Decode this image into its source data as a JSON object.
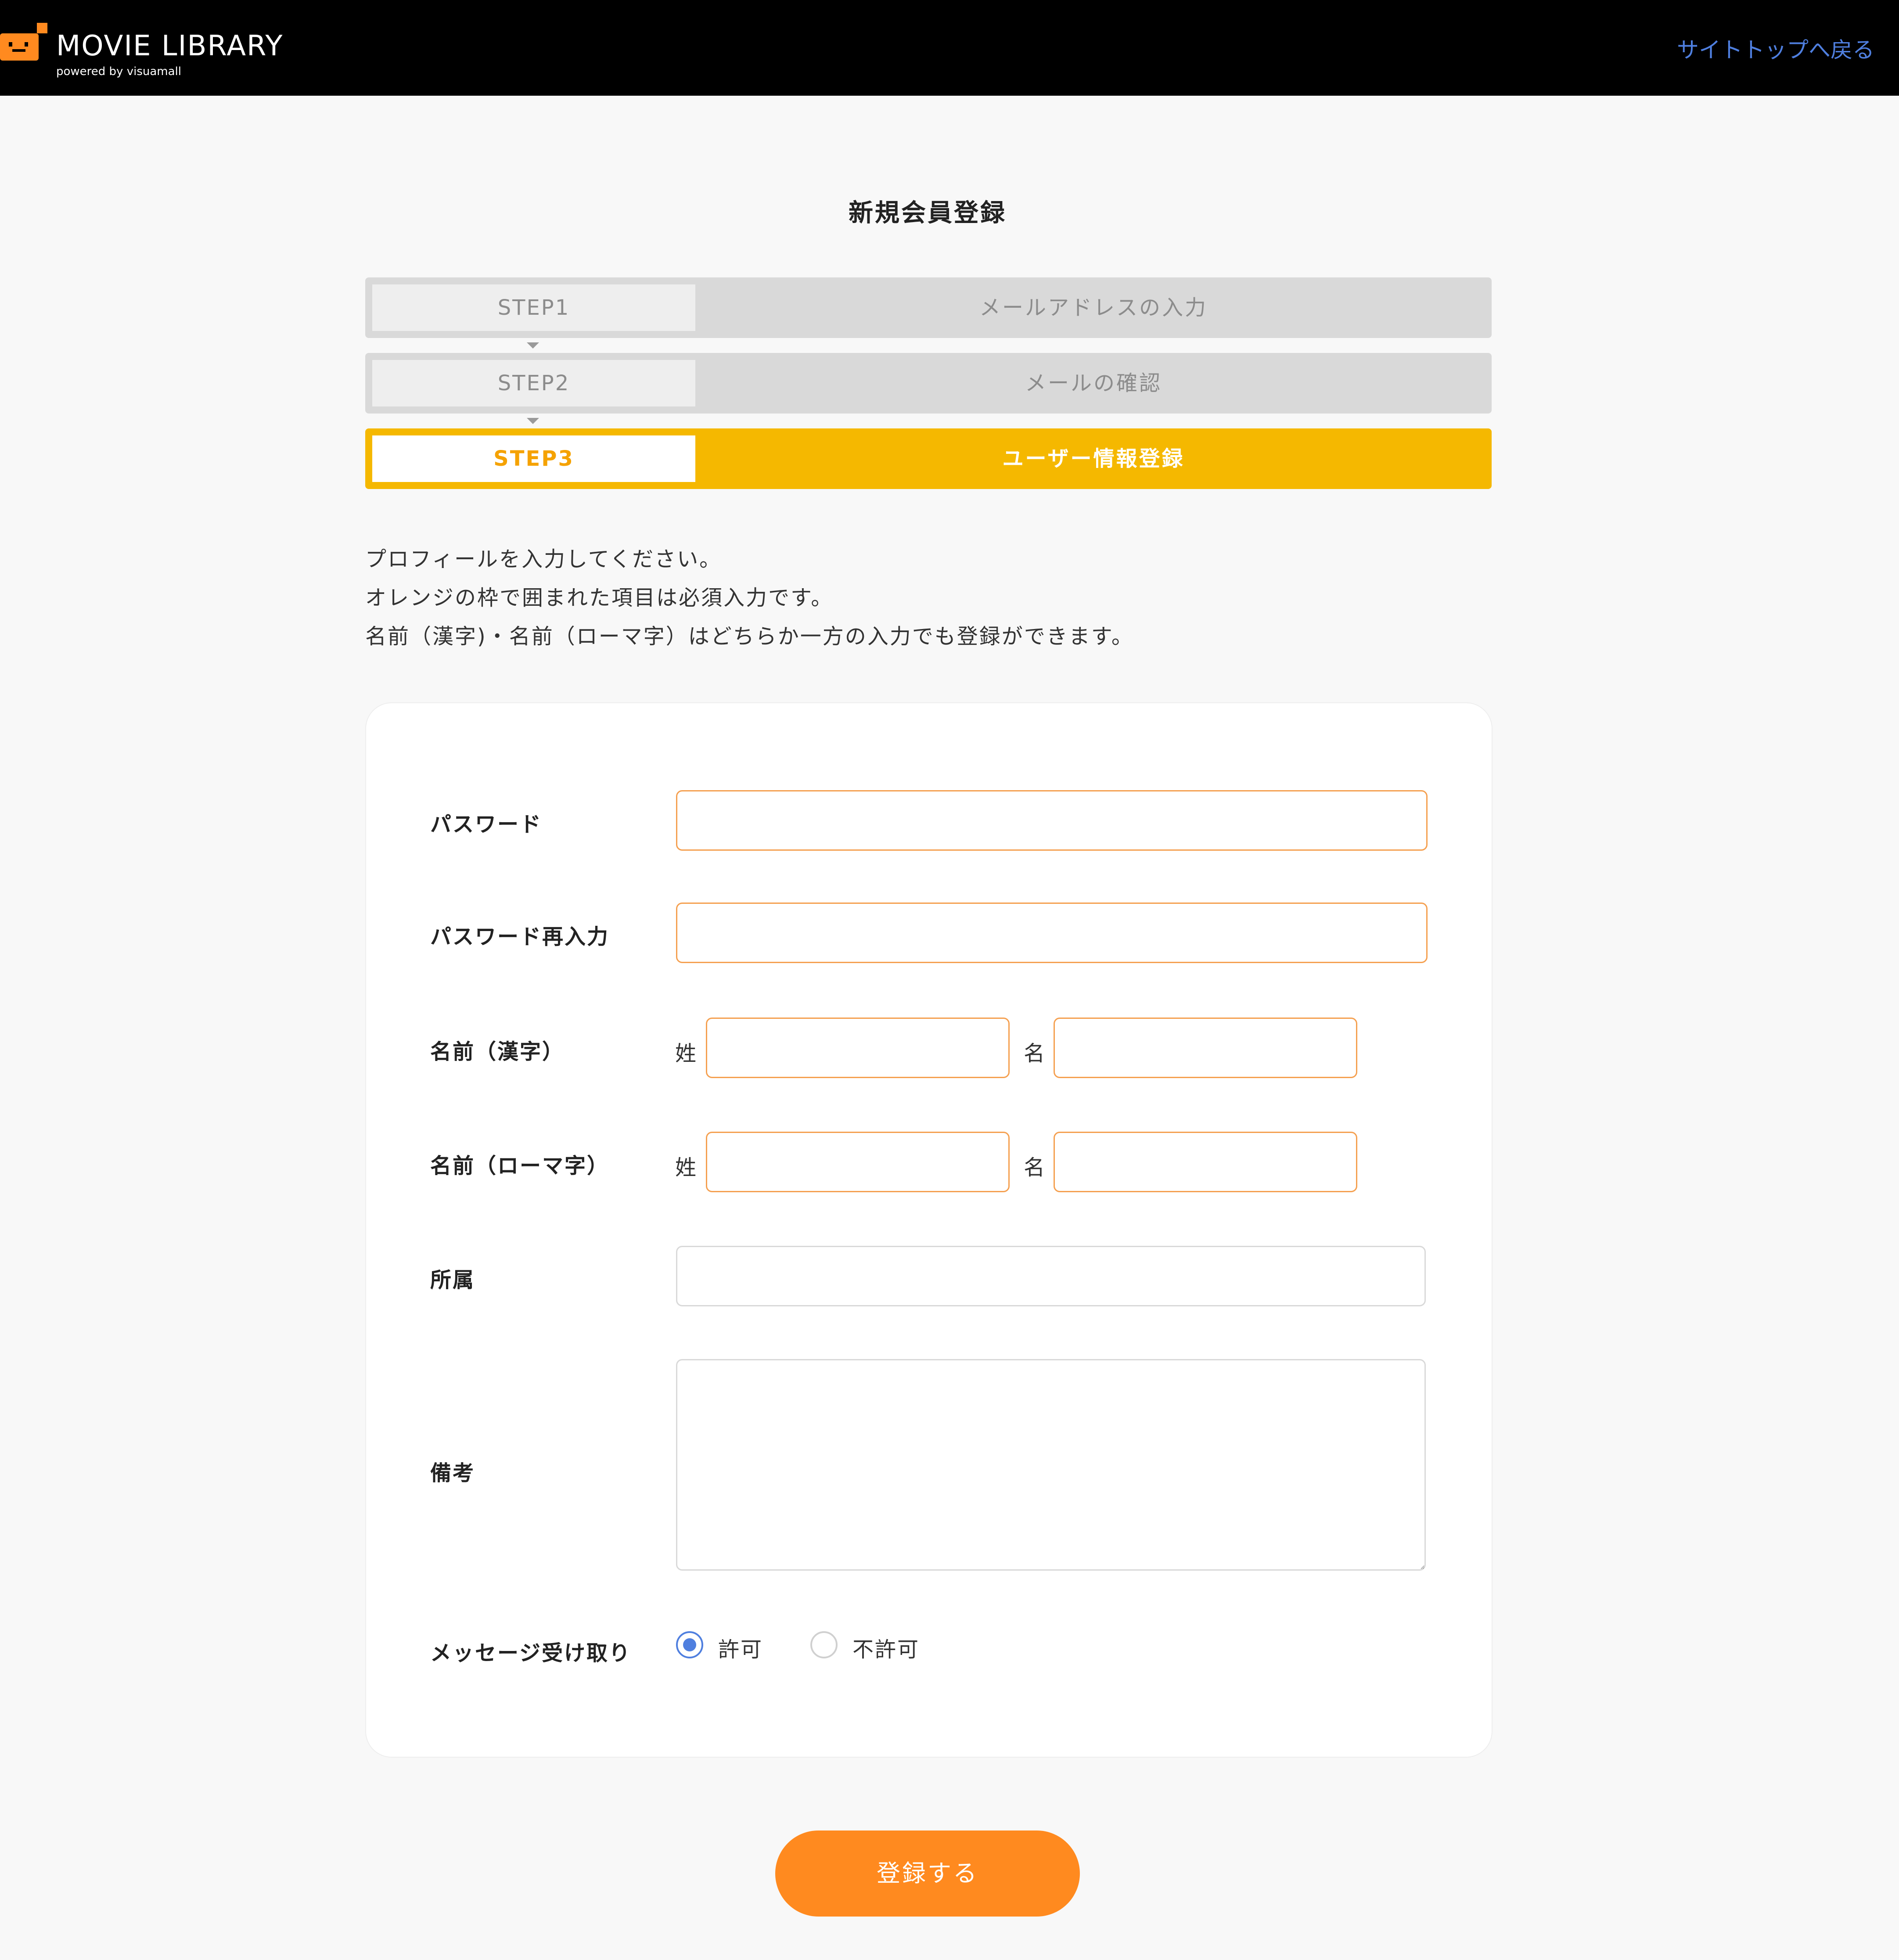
{
  "header": {
    "logo_title": "MOVIE LIBRARY",
    "logo_subtitle": "powered by visuamall",
    "back_link": "サイトトップへ戻る",
    "logo_color": "#ff8a1f"
  },
  "page": {
    "title": "新規会員登録"
  },
  "steps": [
    {
      "number": "STEP1",
      "label": "メールアドレスの入力",
      "state": "done"
    },
    {
      "number": "STEP2",
      "label": "メールの確認",
      "state": "done"
    },
    {
      "number": "STEP3",
      "label": "ユーザー情報登録",
      "state": "active"
    }
  ],
  "intro": {
    "lines": [
      "プロフィールを入力してください。",
      "オレンジの枠で囲まれた項目は必須入力です。",
      "名前（漢字)・名前（ローマ字）はどちらか一方の入力でも登録ができます。"
    ]
  },
  "form": {
    "password": {
      "label": "パスワード",
      "value": "",
      "required": true
    },
    "password_confirm": {
      "label": "パスワード再入力",
      "value": "",
      "required": true
    },
    "name_kanji": {
      "label": "名前（漢字）",
      "last_label": "姓",
      "last_value": "",
      "first_label": "名",
      "first_value": "",
      "required": true
    },
    "name_roman": {
      "label": "名前（ローマ字）",
      "last_label": "姓",
      "last_value": "",
      "first_label": "名",
      "first_value": "",
      "required": true
    },
    "affiliation": {
      "label": "所属",
      "value": "",
      "required": false
    },
    "notes": {
      "label": "備考",
      "value": "",
      "required": false
    },
    "messages": {
      "label": "メッセージ受け取り",
      "options": [
        "許可",
        "不許可"
      ],
      "selected": "許可"
    }
  },
  "submit": {
    "label": "登録する"
  },
  "colors": {
    "accent_orange": "#ff8a1f",
    "required_border": "#f5a050",
    "active_step": "#f5b800",
    "link_blue": "#4f7fdf",
    "inactive_step": "#d9d9d9"
  }
}
